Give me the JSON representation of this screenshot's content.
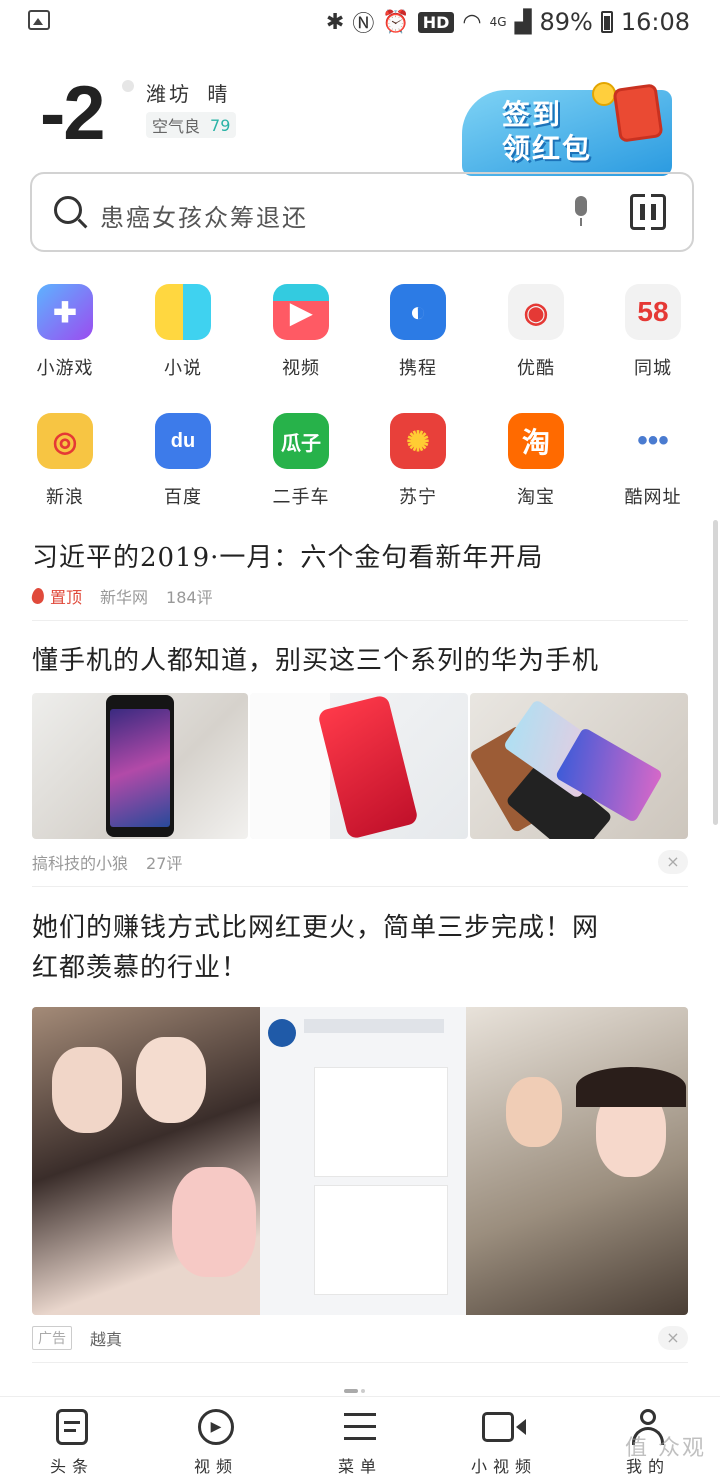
{
  "status_bar": {
    "network": "4G",
    "hd": "HD",
    "battery": "89%",
    "time": "16:08"
  },
  "weather": {
    "temperature": "-2",
    "city": "潍坊",
    "condition": "晴",
    "air_label": "空气良",
    "air_value": "79"
  },
  "signin_banner": {
    "line1": "签到",
    "line2": "领红包"
  },
  "search": {
    "placeholder": "患癌女孩众筹退还"
  },
  "apps": [
    {
      "label": "小游戏",
      "icon": "gamepad-icon",
      "color": "#8a5af0"
    },
    {
      "label": "小说",
      "icon": "novel-icon",
      "color": "#3fd2f0"
    },
    {
      "label": "视频",
      "icon": "play-icon",
      "color": "#ff5a64"
    },
    {
      "label": "携程",
      "icon": "ctrip-dolphin-icon",
      "color": "#2c7be5"
    },
    {
      "label": "优酷",
      "icon": "youku-icon",
      "color": "#f2f2f2"
    },
    {
      "label": "同城",
      "icon": "58-icon",
      "color": "#f2f2f2",
      "text": "58"
    },
    {
      "label": "新浪",
      "icon": "weibo-eye-icon",
      "color": "#f7c543"
    },
    {
      "label": "百度",
      "icon": "baidu-paw-icon",
      "color": "#3d7bea",
      "text": "du"
    },
    {
      "label": "二手车",
      "icon": "guazi-icon",
      "color": "#27b24a",
      "text": "瓜子"
    },
    {
      "label": "苏宁",
      "icon": "suning-lion-icon",
      "color": "#e8403a"
    },
    {
      "label": "淘宝",
      "icon": "taobao-icon",
      "color": "#ff6a00",
      "text": "淘"
    },
    {
      "label": "酷网址",
      "icon": "more-dots-icon",
      "color": "#ffffff"
    }
  ],
  "feed": [
    {
      "title": "习近平的2019·一月：六个金句看新年开局",
      "pin": "置顶",
      "source": "新华网",
      "comments": "184评"
    },
    {
      "title": "懂手机的人都知道，别买这三个系列的华为手机",
      "source": "搞科技的小狼",
      "comments": "27评",
      "close": "×"
    },
    {
      "title_line1": "她们的赚钱方式比网红更火，简单三步完成！网",
      "title_line2": "红都羡慕的行业！",
      "ad_tag": "广告",
      "source": "越真",
      "close": "×"
    }
  ],
  "bottom_nav": [
    {
      "label": "头条",
      "icon": "news-icon"
    },
    {
      "label": "视频",
      "icon": "video-play-icon"
    },
    {
      "label": "菜单",
      "icon": "menu-icon"
    },
    {
      "label": "小视频",
      "icon": "camera-icon"
    },
    {
      "label": "我的",
      "icon": "user-icon"
    }
  ],
  "watermark": "值 众观"
}
